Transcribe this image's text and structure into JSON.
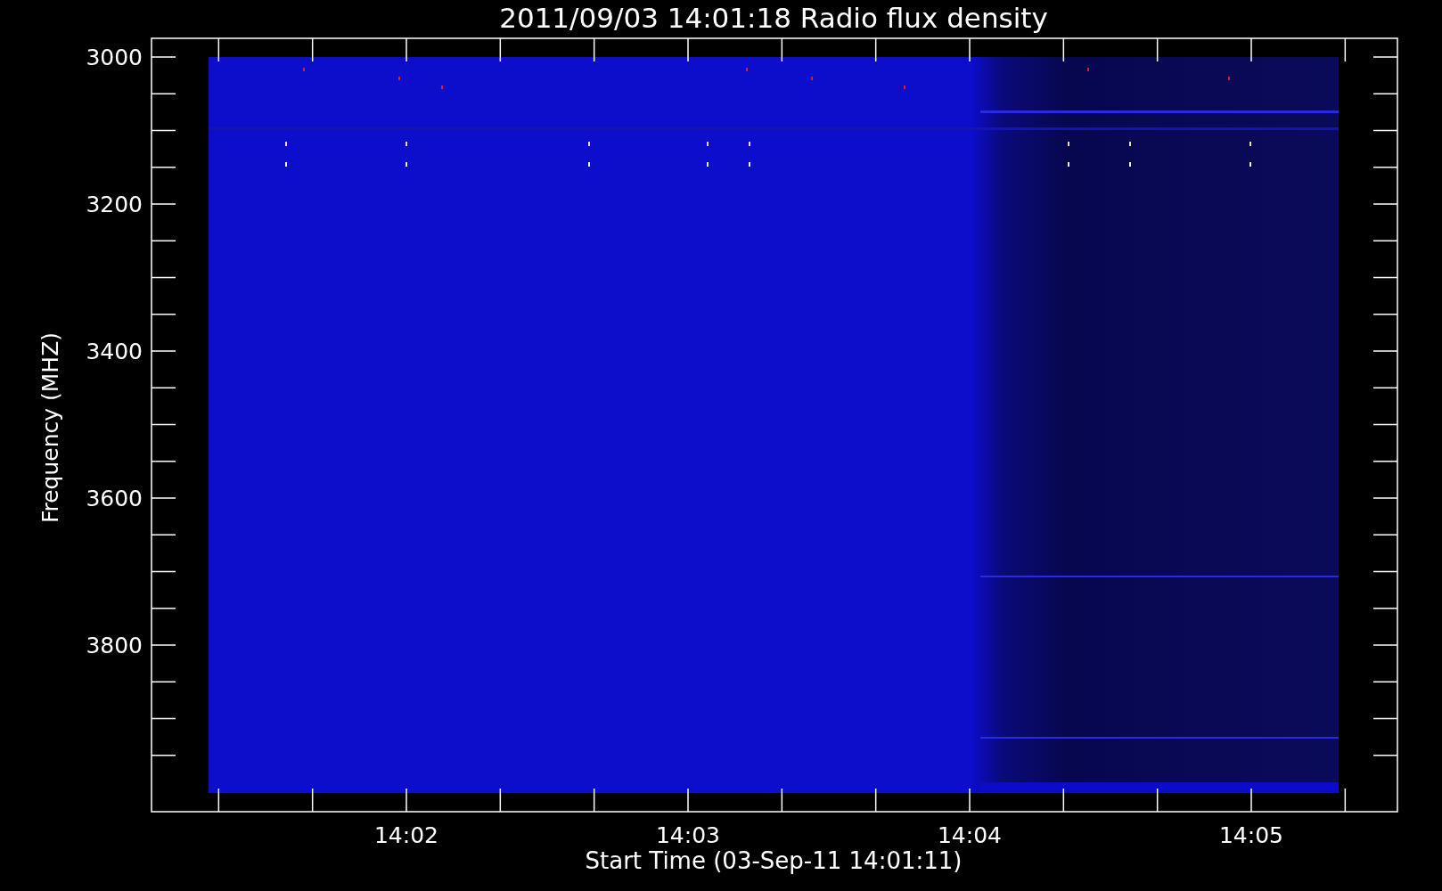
{
  "title": "2011/09/03 14:01:18 Radio flux density",
  "xlabel": "Start Time (03-Sep-11 14:01:11)",
  "ylabel": "Frequency (MHZ)",
  "yticks": [
    "3000",
    "3200",
    "3400",
    "3600",
    "3800"
  ],
  "xticks": [
    "14:02",
    "14:03",
    "14:04",
    "14:05"
  ]
}
